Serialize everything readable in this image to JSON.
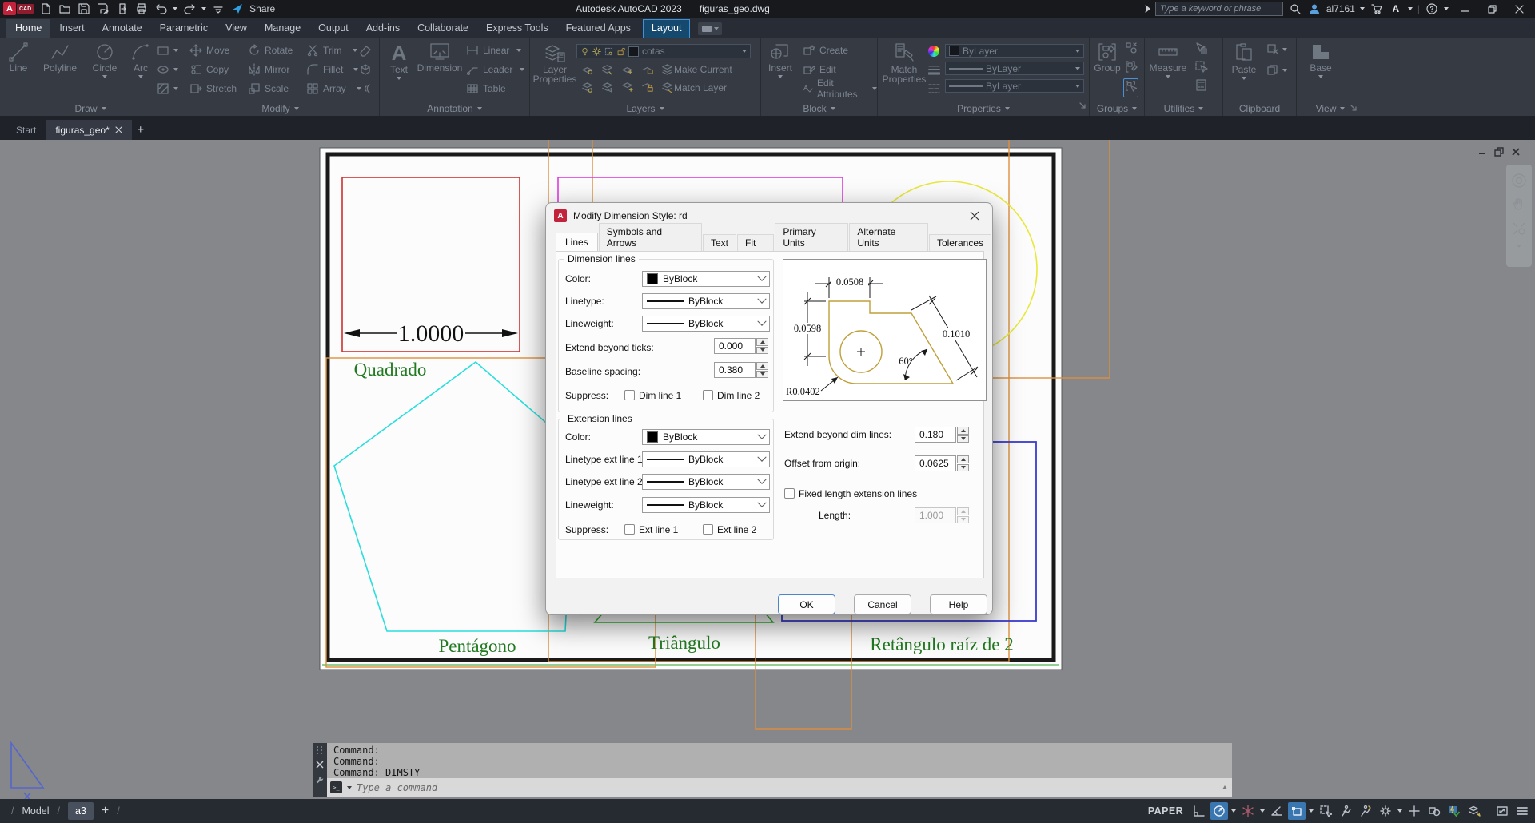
{
  "titlebar": {
    "share": "Share",
    "app_title": "Autodesk AutoCAD 2023",
    "doc_title": "figuras_geo.dwg",
    "search_placeholder": "Type a keyword or phrase",
    "username": "al7161"
  },
  "menu": {
    "tabs": [
      "Home",
      "Insert",
      "Annotate",
      "Parametric",
      "View",
      "Manage",
      "Output",
      "Add-ins",
      "Collaborate",
      "Express Tools",
      "Featured Apps",
      "Layout"
    ]
  },
  "ribbon": {
    "draw": {
      "title": "Draw",
      "items": [
        "Line",
        "Polyline",
        "Circle",
        "Arc"
      ]
    },
    "modify": {
      "title": "Modify",
      "col1": [
        "Move",
        "Copy",
        "Stretch"
      ],
      "col2": [
        "Rotate",
        "Mirror",
        "Scale"
      ],
      "col3": [
        "Trim",
        "Fillet",
        "Array"
      ]
    },
    "annotation": {
      "title": "Annotation",
      "text": "Text",
      "dimension": "Dimension",
      "linear": "Linear",
      "leader": "Leader",
      "table": "Table"
    },
    "layers": {
      "title": "Layers",
      "layer_properties_line1": "Layer",
      "layer_properties_line2": "Properties",
      "current_layer": "cotas",
      "make_current": "Make Current",
      "match_layer": "Match Layer"
    },
    "block": {
      "title": "Block",
      "insert": "Insert",
      "create": "Create",
      "edit": "Edit",
      "edit_attributes": "Edit Attributes"
    },
    "properties": {
      "title": "Properties",
      "match_line1": "Match",
      "match_line2": "Properties",
      "color_value": "ByLayer",
      "lineweight_value": "ByLayer",
      "linetype_value": "ByLayer"
    },
    "groups": {
      "title": "Groups",
      "group": "Group"
    },
    "utilities": {
      "title": "Utilities",
      "measure": "Measure"
    },
    "clipboard": {
      "title": "Clipboard",
      "paste": "Paste"
    },
    "view": {
      "title": "View",
      "base": "Base"
    }
  },
  "file_tabs": {
    "start": "Start",
    "document": "figuras_geo*"
  },
  "canvas": {
    "square_dim": "1.0000",
    "label_square": "Quadrado",
    "label_pentagon": "Pentágono",
    "label_triangle": "Triângulo",
    "label_rectangle": "Retângulo raíz de 2"
  },
  "dialog": {
    "title": "Modify Dimension Style: rd",
    "tabs": [
      "Lines",
      "Symbols and Arrows",
      "Text",
      "Fit",
      "Primary Units",
      "Alternate Units",
      "Tolerances"
    ],
    "dimension_lines": {
      "legend": "Dimension lines",
      "color_label": "Color:",
      "color_value": "ByBlock",
      "linetype_label": "Linetype:",
      "linetype_value": "ByBlock",
      "lineweight_label": "Lineweight:",
      "lineweight_value": "ByBlock",
      "extend_label": "Extend beyond ticks:",
      "extend_value": "0.000",
      "baseline_label": "Baseline spacing:",
      "baseline_value": "0.380",
      "suppress_label": "Suppress:",
      "dim_line_1": "Dim line 1",
      "dim_line_2": "Dim line 2"
    },
    "extension_lines": {
      "legend": "Extension lines",
      "color_label": "Color:",
      "color_value": "ByBlock",
      "linetype1_label": "Linetype ext line 1:",
      "linetype1_value": "ByBlock",
      "linetype2_label": "Linetype ext line 2:",
      "linetype2_value": "ByBlock",
      "lineweight_label": "Lineweight:",
      "lineweight_value": "ByBlock",
      "suppress_label": "Suppress:",
      "ext_line_1": "Ext line 1",
      "ext_line_2": "Ext line 2"
    },
    "right_panel": {
      "extend_dim_label": "Extend beyond dim lines:",
      "extend_dim_value": "0.180",
      "offset_label": "Offset from origin:",
      "offset_value": "0.0625",
      "fixed_length_label": "Fixed length extension lines",
      "length_label": "Length:",
      "length_value": "1.000"
    },
    "preview": {
      "dim_top": "0.0508",
      "dim_left": "0.0598",
      "dim_diagonal": "0.1010",
      "dim_angle": "60°",
      "dim_radius": "R0.0402"
    },
    "buttons": {
      "ok": "OK",
      "cancel": "Cancel",
      "help": "Help"
    }
  },
  "command": {
    "line1": "Command:",
    "line2": "Command:",
    "line3": "Command: DIMSTY",
    "placeholder": "Type a command"
  },
  "status": {
    "model": "Model",
    "layout_tab": "a3",
    "space": "PAPER"
  },
  "colors": {
    "ribbon_accent": "#47a3e8",
    "status_highlight": "#3a76b0",
    "cad_red": "#c2233a",
    "shape_red": "#d03030",
    "shape_magenta": "#e23ae2",
    "shape_yellow": "#e8e838",
    "shape_cyan": "#29dede",
    "shape_green": "#2eb82e",
    "shape_blue": "#3b3bd0",
    "viewport_orange": "#dd8f3d",
    "label_green": "#217a21",
    "preview_gold": "#bfa03a"
  }
}
